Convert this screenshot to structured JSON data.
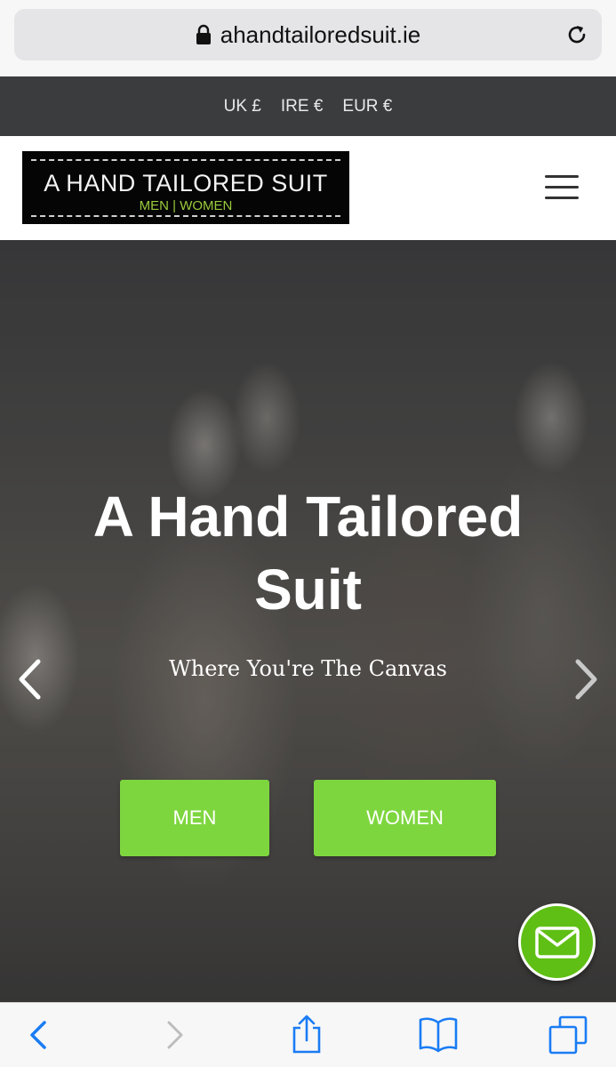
{
  "browser": {
    "url": "ahandtailoredsuit.ie"
  },
  "currency": [
    "UK £",
    "IRE €",
    "EUR €"
  ],
  "logo": {
    "title": "A HAND TAILORED SUIT",
    "subtitle": "MEN | WOMEN"
  },
  "hero": {
    "title": "A Hand Tailored Suit",
    "subtitle": "Where You're The Canvas",
    "buttons": {
      "men": "MEN",
      "women": "WOMEN"
    }
  },
  "colors": {
    "accent_green": "#7ed63f",
    "fab_green": "#5fbf14",
    "ios_blue": "#1a7cf4",
    "currency_bar": "#3b3c3e"
  },
  "icons": {
    "lock": "lock-icon",
    "reload": "reload-icon",
    "menu": "hamburger-menu-icon",
    "prev": "chevron-left-icon",
    "next": "chevron-right-icon",
    "mail": "mail-icon",
    "back": "back-icon",
    "forward": "forward-icon",
    "share": "share-icon",
    "bookmarks": "bookmarks-icon",
    "tabs": "tabs-icon"
  }
}
